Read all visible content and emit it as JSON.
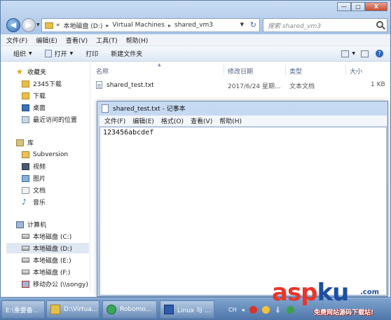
{
  "explorer": {
    "window_buttons": {
      "minimize": "—",
      "maximize": "□",
      "close": "X"
    },
    "address": {
      "history_prefix": "«",
      "parts": [
        "本地磁盘 (D:)",
        "Virtual Machines",
        "shared_vm3"
      ],
      "separator": "▸"
    },
    "search": {
      "placeholder": "搜索 shared_vm3"
    },
    "menu": [
      "文件(F)",
      "编辑(E)",
      "查看(V)",
      "工具(T)",
      "帮助(H)"
    ],
    "toolbar": {
      "organize": "组织",
      "open": "打开",
      "print": "打印",
      "new_folder": "新建文件夹"
    },
    "nav": {
      "favorites": "收藏夹",
      "fav_2345": "2345下载",
      "downloads": "下载",
      "desktop": "桌面",
      "recent": "最近访问的位置",
      "library": "库",
      "subversion": "Subversion",
      "videos": "视频",
      "pictures": "图片",
      "documents": "文档",
      "music": "音乐",
      "computer": "计算机",
      "drive_c": "本地磁盘 (C:)",
      "drive_d": "本地磁盘 (D:)",
      "drive_e": "本地磁盘 (E:)",
      "drive_f": "本地磁盘 (F:)",
      "network": "移动办公 (\\\\songy)"
    },
    "columns": {
      "name": "名称",
      "modified": "修改日期",
      "type": "类型",
      "size": "大小"
    },
    "files": [
      {
        "name": "shared_test.txt",
        "modified": "2017/6/24 星期...",
        "type": "文本文档",
        "size": "1 KB"
      }
    ]
  },
  "notepad": {
    "title": "shared_test.txt - 记事本",
    "menu": [
      "文件(F)",
      "编辑(E)",
      "格式(O)",
      "查看(V)",
      "帮助(H)"
    ],
    "content": "123456abcdef"
  },
  "taskbar": {
    "tasks": [
      "E:\\重要备...",
      "D:\\Virtua...",
      "Robomo...",
      "Linux 与 ..."
    ],
    "tray_lang": "CH"
  },
  "watermark": {
    "logo_a": "asp",
    "logo_b": "ku",
    "logo_com": ".com",
    "slogan": "免费网站源码下载站!"
  },
  "colors": {
    "watermark_red": "#e8362b",
    "watermark_blue": "#1d4ea0",
    "selection": "#dfe7f2"
  }
}
